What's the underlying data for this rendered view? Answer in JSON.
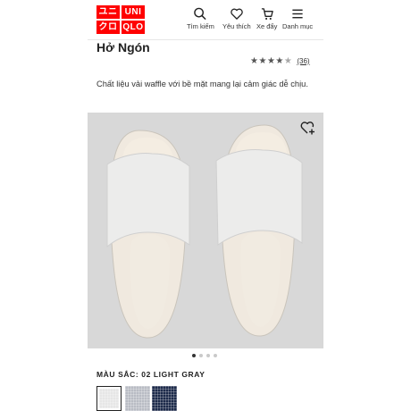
{
  "header": {
    "logo_top": "ユニクロ",
    "logo_bottom": "UNIQLO",
    "logo_cells": [
      "ユニ",
      "UNI",
      "クロ",
      "QLO"
    ],
    "brand_color": "#ff0000",
    "nav": [
      {
        "label": "Tìm kiếm",
        "icon": "search-icon"
      },
      {
        "label": "Yêu thích",
        "icon": "heart-icon"
      },
      {
        "label": "Xe đẩy",
        "icon": "cart-icon"
      },
      {
        "label": "Danh mục",
        "icon": "menu-icon"
      }
    ]
  },
  "product": {
    "title": "Hở Ngón",
    "rating_value": 4.5,
    "rating_max": 5,
    "review_count": "(36)",
    "description": "Chất liệu vải waffle với bề mặt mang lại cảm giác dễ chịu.",
    "image_icon": "slipper-image",
    "carousel": {
      "count": 4,
      "active": 0
    }
  },
  "color": {
    "label": "MÀU SẮC: 02 LIGHT GRAY",
    "swatches": [
      {
        "name": "light-gray",
        "color": "#e6e6e6",
        "selected": true
      },
      {
        "name": "gray",
        "color": "#b9bcc4",
        "selected": false
      },
      {
        "name": "navy",
        "color": "#1c2a4a",
        "selected": false
      }
    ]
  }
}
